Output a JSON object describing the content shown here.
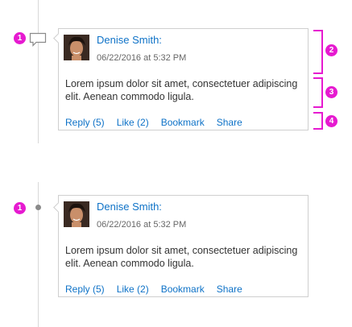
{
  "colors": {
    "accent": "#e61ad0",
    "link": "#0e72c7",
    "border": "#cfcfcf"
  },
  "callouts": {
    "one": "1",
    "two": "2",
    "three": "3",
    "four": "4"
  },
  "icons": {
    "timeline_top": "comment-icon",
    "timeline_bottom": "dot-icon"
  },
  "comments": [
    {
      "author": "Denise Smith:",
      "timestamp": "06/22/2016 at 5:32 PM",
      "body": "Lorem ipsum dolor sit amet, consectetuer adipiscing elit. Aenean commodo ligula.",
      "actions": {
        "reply": "Reply (5)",
        "like": "Like (2)",
        "bookmark": "Bookmark",
        "share": "Share"
      }
    },
    {
      "author": "Denise Smith:",
      "timestamp": "06/22/2016 at 5:32 PM",
      "body": "Lorem ipsum dolor sit amet, consectetuer adipiscing elit. Aenean commodo ligula.",
      "actions": {
        "reply": "Reply (5)",
        "like": "Like (2)",
        "bookmark": "Bookmark",
        "share": "Share"
      }
    }
  ]
}
